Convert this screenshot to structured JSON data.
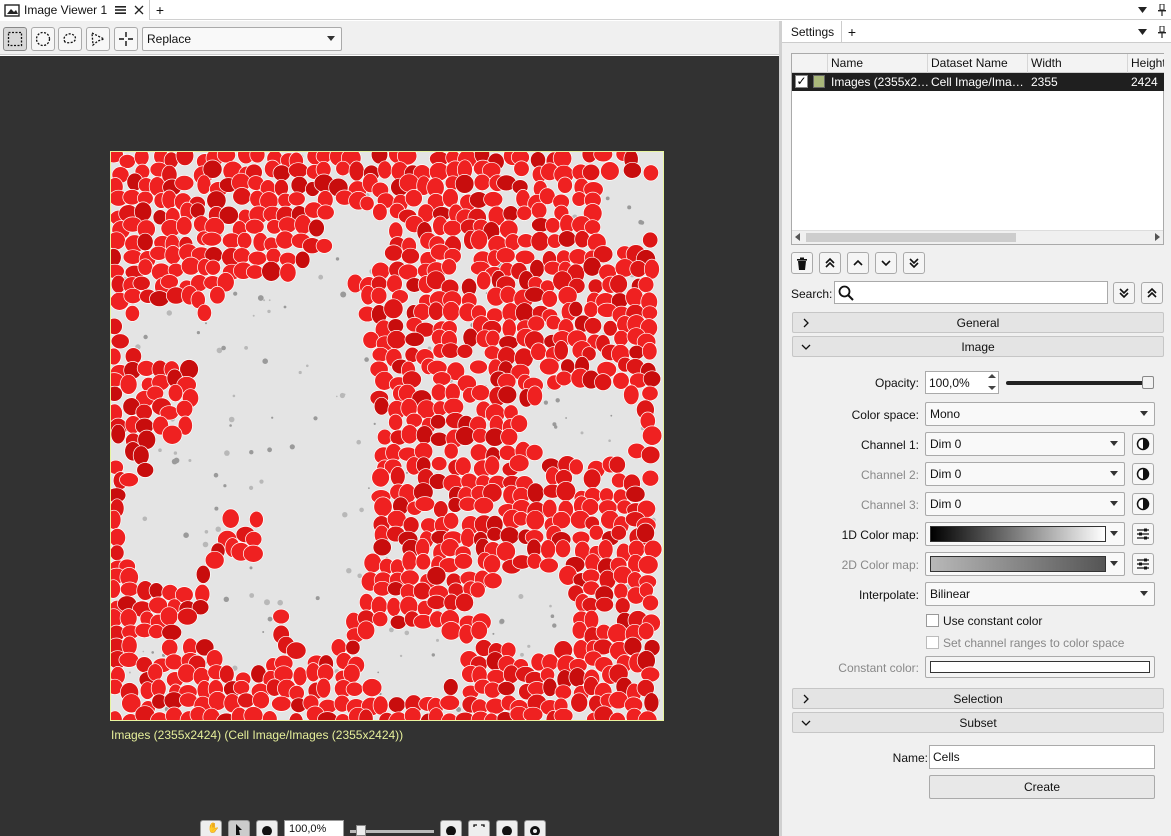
{
  "tabs": {
    "viewer_title": "Image Viewer 1"
  },
  "toolbar": {
    "mode": "Replace"
  },
  "viewer": {
    "caption": "Images (2355x2424) (Cell Image/Images (2355x2424))"
  },
  "bottom": {
    "zoom": "100,0%"
  },
  "settings": {
    "tab": "Settings",
    "table": {
      "columns": [
        "Name",
        "Dataset Name",
        "Width",
        "Height"
      ],
      "row": {
        "name": "Images (2355x2…",
        "dataset": "Cell Image/Ima…",
        "width": "2355",
        "height": "2424",
        "color": "#a9b77a"
      }
    },
    "search": {
      "label": "Search:",
      "value": ""
    },
    "sections": {
      "general": "General",
      "image": "Image",
      "selection": "Selection",
      "subset": "Subset"
    },
    "image": {
      "opacity_label": "Opacity:",
      "opacity_value": "100,0%",
      "opacity_fraction": 1.0,
      "color_space_label": "Color space:",
      "color_space": "Mono",
      "channel1_label": "Channel 1:",
      "channel1": "Dim 0",
      "channel2_label": "Channel 2:",
      "channel2": "Dim 0",
      "channel3_label": "Channel 3:",
      "channel3": "Dim 0",
      "cmap1_label": "1D Color map:",
      "cmap2_label": "2D Color map:",
      "interpolate_label": "Interpolate:",
      "interpolate": "Bilinear",
      "use_constant_label": "Use constant color",
      "set_ranges_label": "Set channel ranges to color space",
      "constant_label": "Constant color:"
    },
    "subset": {
      "name_label": "Name:",
      "name_value": "Cells",
      "create_label": "Create"
    }
  },
  "colors": {
    "accent_frame": "#e8f5a0",
    "caption": "#e6ef9a",
    "cell_red": "#ee1c1c",
    "viewer_bg": "#323232"
  }
}
